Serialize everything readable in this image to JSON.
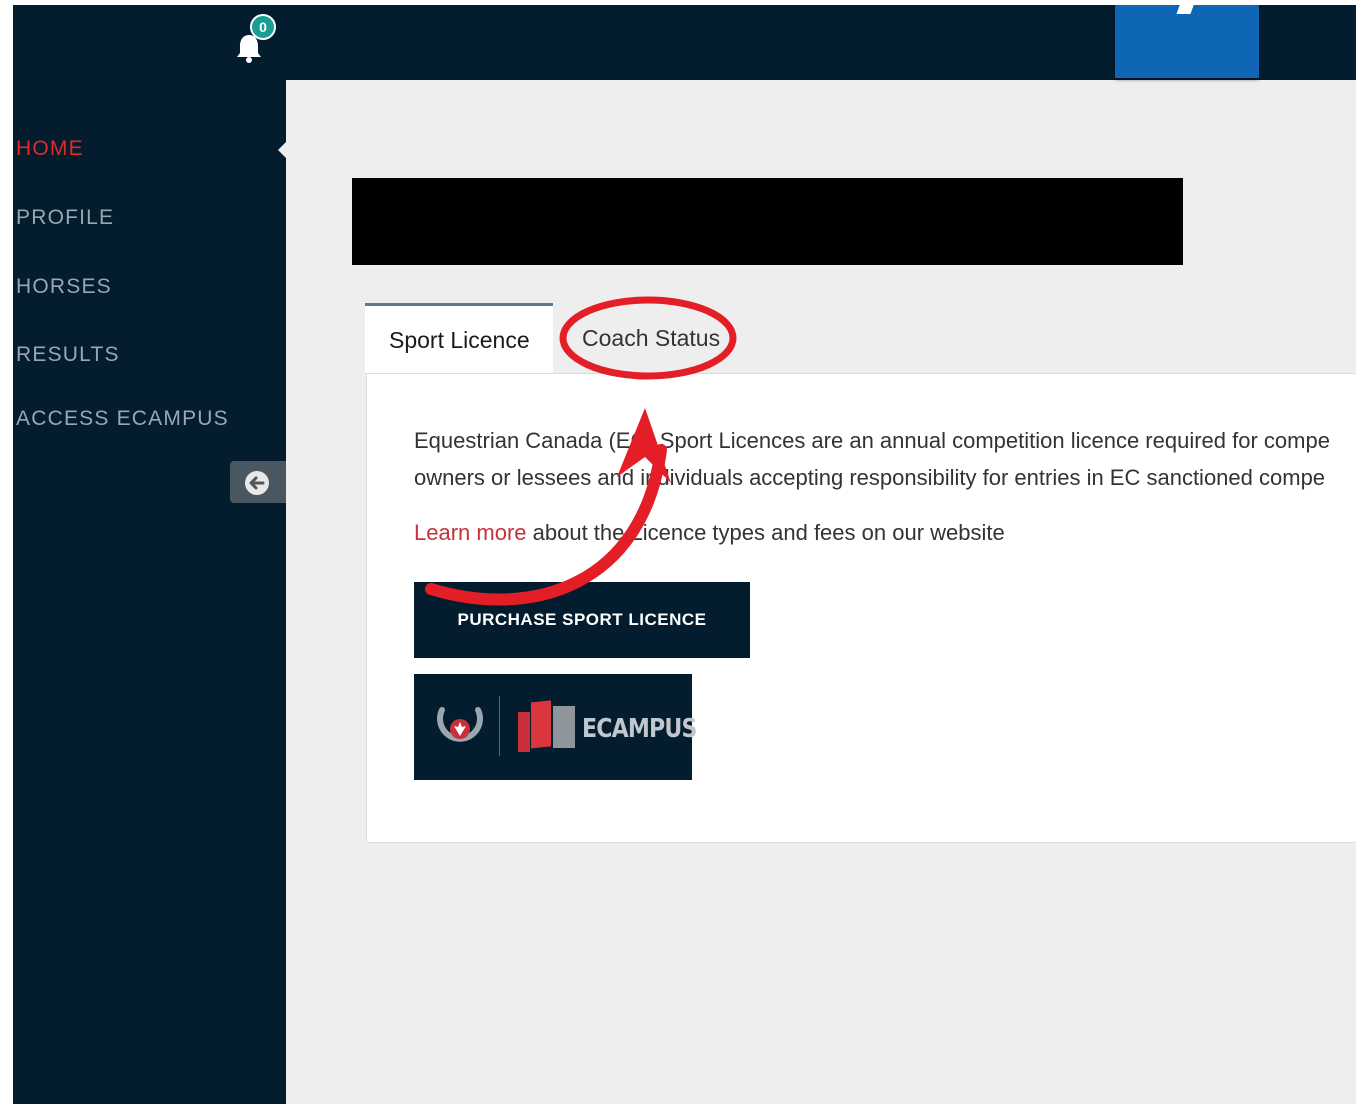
{
  "header": {
    "notification_count": "0",
    "icons": {
      "notifications": "bell-icon"
    }
  },
  "sidebar": {
    "items": [
      {
        "label": "HOME",
        "active": true
      },
      {
        "label": "PROFILE",
        "active": false
      },
      {
        "label": "HORSES",
        "active": false
      },
      {
        "label": "RESULTS",
        "active": false
      },
      {
        "label": "ACCESS ECAMPUS",
        "active": false
      }
    ],
    "collapse_icon": "arrow-left-circle-icon"
  },
  "tabs": [
    {
      "label": "Sport Licence",
      "active": true
    },
    {
      "label": "Coach Status",
      "active": false
    }
  ],
  "content": {
    "description_line1": "Equestrian Canada (EC) Sport Licences are an annual competition licence required for compe",
    "description_line2": "owners or lessees and individuals accepting responsibility for entries in EC sanctioned compe",
    "learn_more_link": "Learn more",
    "learn_more_rest": " about the Licence types and fees on our website",
    "purchase_button": "PURCHASE SPORT LICENCE",
    "ecampus_label": "ECAMPUS"
  },
  "colors": {
    "navy": "#031c2e",
    "active_red": "#e02a2a",
    "link_red": "#c8313c",
    "badge_teal": "#1a9e94",
    "accent_blue": "#0e66b4",
    "annotation_red": "#e41e26"
  }
}
